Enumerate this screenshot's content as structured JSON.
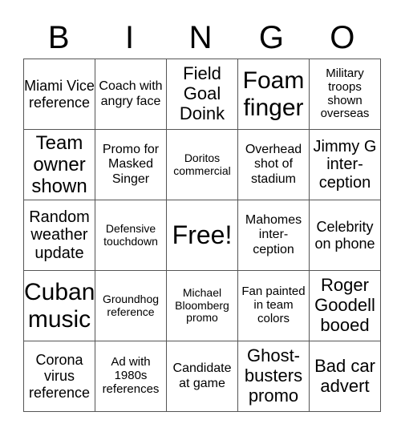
{
  "header": [
    "B",
    "I",
    "N",
    "G",
    "O"
  ],
  "rows": [
    [
      "Miami Vice reference",
      "Coach with angry face",
      "Field Goal Doink",
      "Foam finger",
      "Military troops shown overseas"
    ],
    [
      "Team owner shown",
      "Promo for Masked Singer",
      "Doritos commercial",
      "Overhead shot of stadium",
      "Jimmy G inter- ception"
    ],
    [
      "Random weather update",
      "Defensive touchdown",
      "Free!",
      "Mahomes inter- ception",
      "Celebrity on phone"
    ],
    [
      "Cuban music",
      "Groundhog reference",
      "Michael Bloomberg promo",
      "Fan painted in team colors",
      "Roger Goodell booed"
    ],
    [
      "Corona virus reference",
      "Ad with 1980s references",
      "Candidate at game",
      "Ghost- busters promo",
      "Bad car advert"
    ]
  ]
}
